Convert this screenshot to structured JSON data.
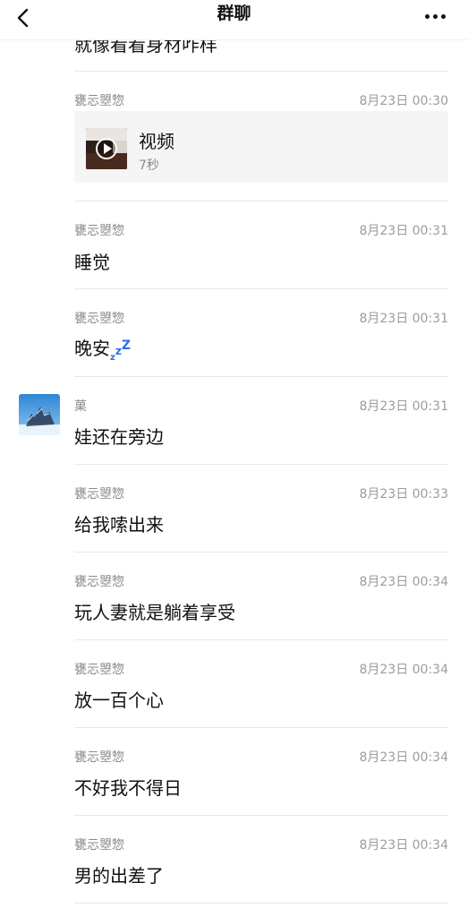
{
  "header": {
    "title": "群聊"
  },
  "partial_message": {
    "text": "就像看看身材咋样"
  },
  "messages": [
    {
      "sender": "甕忈曌惣",
      "time": "8月23日 00:30",
      "video": {
        "title": "视频",
        "duration": "7秒"
      }
    },
    {
      "sender": "甕忈曌惣",
      "time": "8月23日 00:31",
      "text": "睡觉"
    },
    {
      "sender": "甕忈曌惣",
      "time": "8月23日 00:31",
      "text": "晚安",
      "emoji": "zzz"
    },
    {
      "sender": "菓",
      "time": "8月23日 00:31",
      "text": "娃还在旁边"
    },
    {
      "sender": "甕忈曌惣",
      "time": "8月23日 00:33",
      "text": "给我嗦出来"
    },
    {
      "sender": "甕忈曌惣",
      "time": "8月23日 00:34",
      "text": "玩人妻就是躺着享受"
    },
    {
      "sender": "甕忈曌惣",
      "time": "8月23日 00:34",
      "text": "放一百个心"
    },
    {
      "sender": "甕忈曌惣",
      "time": "8月23日 00:34",
      "text": "不好我不得日"
    },
    {
      "sender": "甕忈曌惣",
      "time": "8月23日 00:34",
      "text": "男的出差了"
    }
  ],
  "icons": {
    "back": "chevron-left-icon",
    "more": "more-dots-icon",
    "play": "play-icon",
    "sleep": "zzz-icon"
  },
  "colors": {
    "zzz": "#2d6fe8",
    "divider": "#e8e8e8",
    "card": "#f5f5f5"
  }
}
